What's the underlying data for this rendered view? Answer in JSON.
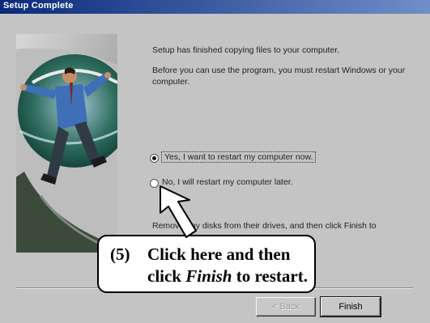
{
  "window": {
    "title": "Setup Complete"
  },
  "content": {
    "line1": "Setup has finished copying files to your computer.",
    "line2": "Before you can use the program, you must restart Windows or your computer.",
    "bottom_text": "Remove any disks from their drives, and then click Finish to"
  },
  "options": [
    {
      "label": "Yes, I want to restart my computer now.",
      "selected": true
    },
    {
      "label": "No, I will restart my computer later.",
      "selected": false
    }
  ],
  "buttons": {
    "back": "< Back",
    "finish": "Finish"
  },
  "callout": {
    "number": "(5)",
    "line1": "Click here and then",
    "line2_prefix": "click ",
    "line2_emphasis": "Finish",
    "line2_suffix": " to restart."
  },
  "colors": {
    "titlebar_start": "#0a2a7a",
    "titlebar_end": "#6f8fc9",
    "dialog_bg": "#c4c4c4"
  }
}
